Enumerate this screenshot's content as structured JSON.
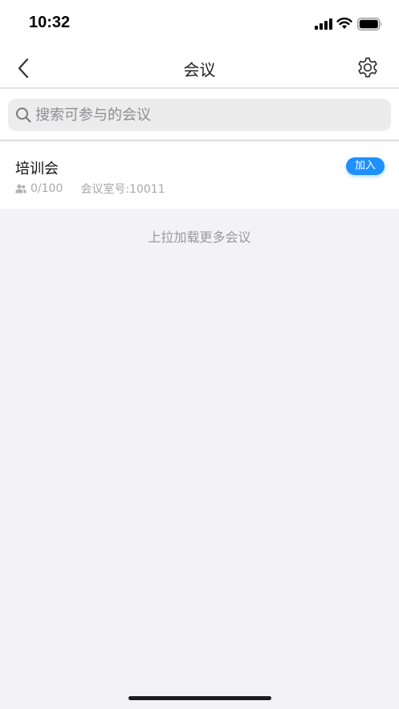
{
  "status_bar": {
    "time": "10:32"
  },
  "nav": {
    "title": "会议"
  },
  "search": {
    "placeholder": "搜索可参与的会议",
    "value": ""
  },
  "meetings": [
    {
      "title": "培训会",
      "participants": "0/100",
      "room": "会议室号:10011",
      "join_label": "加入"
    }
  ],
  "load_more": "上拉加载更多会议",
  "colors": {
    "accent": "#1e90ff",
    "background": "#f2f2f7"
  }
}
